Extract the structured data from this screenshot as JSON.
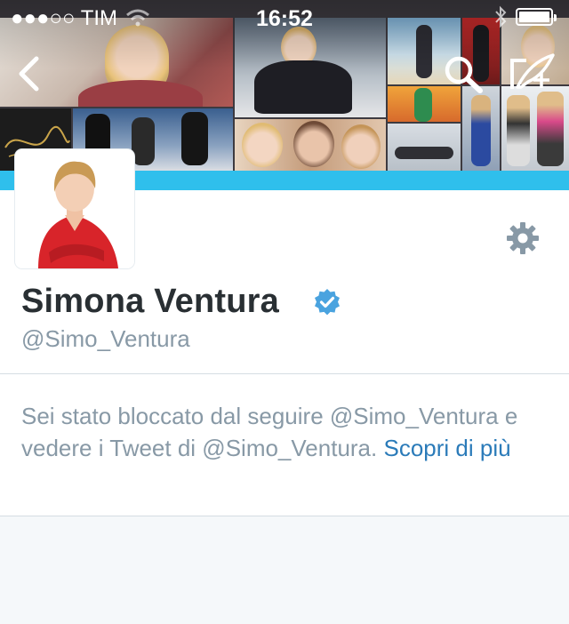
{
  "status_bar": {
    "carrier": "●●●○○ TIM",
    "time": "16:52"
  },
  "header": {
    "back_icon": "chevron-left-icon",
    "search_icon": "search-icon",
    "compose_icon": "compose-tweet-icon"
  },
  "profile": {
    "name": "Simona Ventura",
    "handle": "@Simo_Ventura",
    "verified": true,
    "settings_icon": "gear-icon"
  },
  "notice": {
    "text": "Sei stato bloccato dal seguire @Simo_Ventura e vedere i Tweet di @Simo_Ventura.",
    "link_label": "Scopri di più"
  },
  "colors": {
    "brand_blue": "#2fbfec",
    "link_blue": "#2b7bb9",
    "name_text": "#292f33",
    "muted_text": "#8899a6"
  }
}
